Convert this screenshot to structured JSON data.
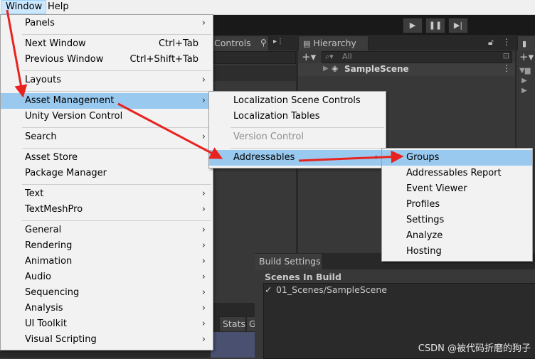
{
  "menubar": {
    "window": "Window",
    "help": "Help"
  },
  "toolbar": {
    "play_icon": "play-icon",
    "pause_icon": "pause-icon",
    "step_icon": "step-icon"
  },
  "background": {
    "controls_tab": "Controls",
    "hierarchy_tab": "Hierarchy",
    "hierarchy_search_placeholder": "All",
    "hierarchy_scene": "SampleScene",
    "stats_tab": "Stats",
    "g_tab": "G"
  },
  "window_menu": {
    "items": [
      {
        "label": "Panels",
        "submenu": true
      },
      {
        "label": "Next Window",
        "shortcut": "Ctrl+Tab"
      },
      {
        "label": "Previous Window",
        "shortcut": "Ctrl+Shift+Tab"
      },
      {
        "label": "Layouts",
        "submenu": true
      },
      {
        "label": "Asset Management",
        "submenu": true,
        "highlighted": true
      },
      {
        "label": "Unity Version Control"
      },
      {
        "label": "Search",
        "submenu": true
      },
      {
        "label": "Asset Store"
      },
      {
        "label": "Package Manager"
      },
      {
        "label": "Text",
        "submenu": true
      },
      {
        "label": "TextMeshPro",
        "submenu": true
      },
      {
        "label": "General",
        "submenu": true
      },
      {
        "label": "Rendering",
        "submenu": true
      },
      {
        "label": "Animation",
        "submenu": true
      },
      {
        "label": "Audio",
        "submenu": true
      },
      {
        "label": "Sequencing",
        "submenu": true
      },
      {
        "label": "Analysis",
        "submenu": true
      },
      {
        "label": "UI Toolkit",
        "submenu": true
      },
      {
        "label": "Visual Scripting",
        "submenu": true
      }
    ]
  },
  "asset_menu": {
    "items": [
      {
        "label": "Localization Scene Controls"
      },
      {
        "label": "Localization Tables"
      },
      {
        "label": "Version Control",
        "disabled": true
      },
      {
        "label": "Addressables",
        "submenu": true,
        "highlighted": true
      }
    ]
  },
  "addressables_menu": {
    "items": [
      {
        "label": "Groups",
        "highlighted": true
      },
      {
        "label": "Addressables Report"
      },
      {
        "label": "Event Viewer"
      },
      {
        "label": "Profiles"
      },
      {
        "label": "Settings"
      },
      {
        "label": "Analyze"
      },
      {
        "label": "Hosting"
      }
    ]
  },
  "build_settings": {
    "tab": "Build Settings",
    "scenes_header": "Scenes In Build",
    "scene_check": "✓",
    "scene_entry": "01_Scenes/SampleScene"
  },
  "watermark": "CSDN @被代码折磨的狗子",
  "colors": {
    "arrow": "#e8231f",
    "highlight": "#99c9ef"
  }
}
